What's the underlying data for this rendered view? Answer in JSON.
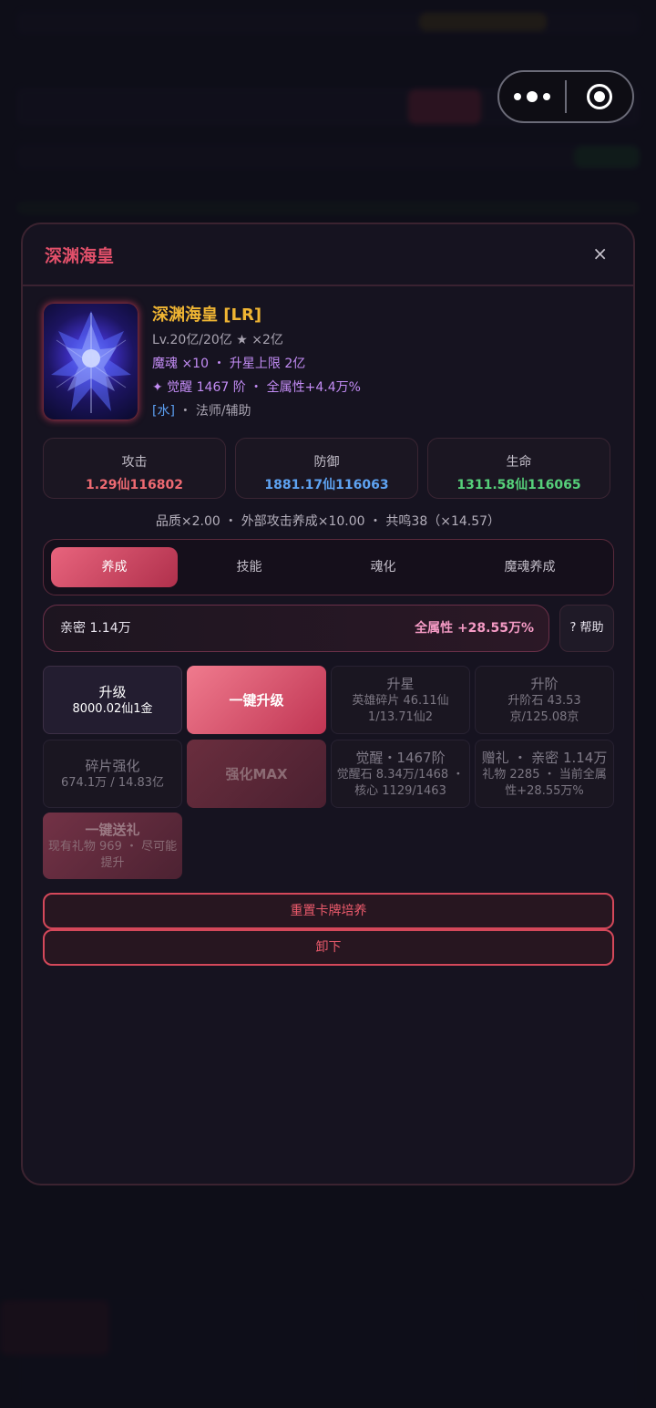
{
  "modal": {
    "title": "深渊海皇",
    "close": "×"
  },
  "hero": {
    "name": "深渊海皇 [LR]",
    "level_line": "Lv.20亿/20亿 ★ ×2亿",
    "soul_line": "魔魂 ×10 ・ 升星上限 2亿",
    "awaken_line": "✦ 觉醒 1467 阶 ・ 全属性+4.4万%",
    "element": "[水]",
    "role": " ・ 法师/辅助"
  },
  "stats": [
    {
      "label": "攻击",
      "value": "1.29仙116802",
      "color": "#ee6a72"
    },
    {
      "label": "防御",
      "value": "1881.17仙116063",
      "color": "#5ea3f2"
    },
    {
      "label": "生命",
      "value": "1311.58仙116065",
      "color": "#56d07a"
    }
  ],
  "multipliers": "品质×2.00 ・ 外部攻击养成×10.00 ・ 共鸣38（×14.57）",
  "tabs": [
    "养成",
    "技能",
    "魂化",
    "魔魂养成"
  ],
  "active_tab": 0,
  "affinity": {
    "left": "亲密 1.14万",
    "right": "全属性 +28.55万%",
    "help": "? 帮助"
  },
  "grid": {
    "upgrade": {
      "title": "升级",
      "sub": "8000.02仙1金"
    },
    "one_click_upgrade": {
      "title": "一键升级"
    },
    "star": {
      "title": "升星",
      "sub": "英雄碎片 46.11仙1/13.71仙2"
    },
    "advance": {
      "title": "升阶",
      "sub": "升阶石 43.53京/125.08京"
    },
    "fragment": {
      "title": "碎片强化",
      "sub": "674.1万 / 14.83亿"
    },
    "strengthen_max": {
      "title": "强化MAX"
    },
    "awaken": {
      "title": "觉醒・1467阶",
      "sub": "觉醒石 8.34万/1468 ・ 核心 1129/1463"
    },
    "gift": {
      "title": "赠礼 ・ 亲密 1.14万",
      "sub": "礼物 2285 ・ 当前全属性+28.55万%"
    },
    "one_click_gift": {
      "title": "一键送礼",
      "sub": "现有礼物 969 ・ 尽可能提升"
    }
  },
  "buttons": {
    "reset": "重置卡牌培养",
    "unequip": "卸下"
  }
}
